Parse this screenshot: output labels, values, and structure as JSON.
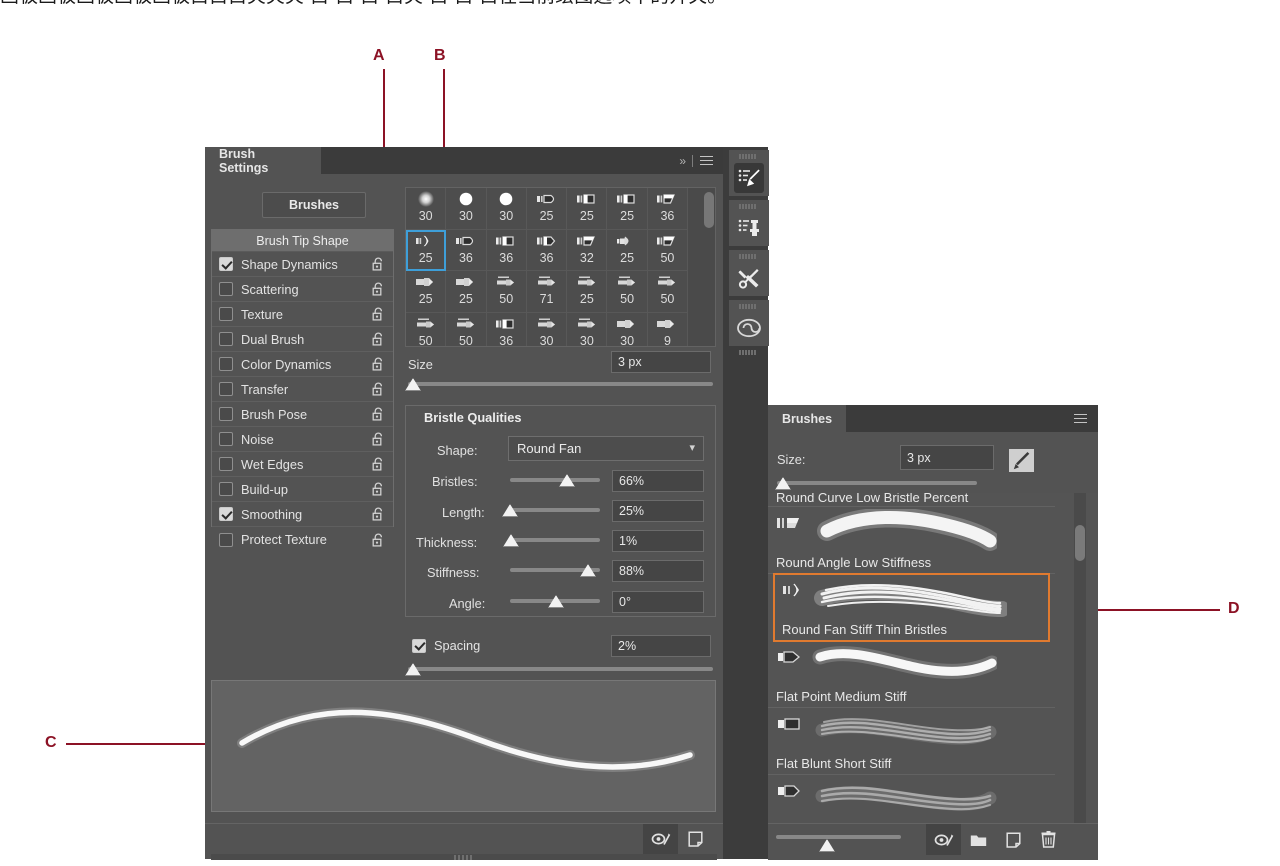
{
  "caption": "画板画板画板画板画板白白白夹夹夹·白·白·白·白夹·白·白·白在当前绘图选项中的开关。",
  "callouts": [
    {
      "id": "A",
      "label": "A"
    },
    {
      "id": "B",
      "label": "B"
    },
    {
      "id": "C",
      "label": "C"
    },
    {
      "id": "D",
      "label": "D"
    }
  ],
  "brush_settings_panel": {
    "tab_label": "Brush Settings",
    "collapse_icon": "chevron-double-right-icon",
    "menu_icon": "panel-menu-icon",
    "brushes_button_label": "Brushes",
    "options": [
      {
        "label": "Brush Tip Shape",
        "type": "header"
      },
      {
        "label": "Shape Dynamics",
        "checked": true,
        "locked": false
      },
      {
        "label": "Scattering",
        "checked": false,
        "locked": false
      },
      {
        "label": "Texture",
        "checked": false,
        "locked": false
      },
      {
        "label": "Dual Brush",
        "checked": false,
        "locked": false
      },
      {
        "label": "Color Dynamics",
        "checked": false,
        "locked": false
      },
      {
        "label": "Transfer",
        "checked": false,
        "locked": false
      },
      {
        "label": "Brush Pose",
        "checked": false,
        "locked": false
      },
      {
        "label": "Noise",
        "checked": false,
        "locked": false
      },
      {
        "label": "Wet Edges",
        "checked": false,
        "locked": false
      },
      {
        "label": "Build-up",
        "checked": false,
        "locked": false
      },
      {
        "label": "Smoothing",
        "checked": true,
        "locked": false
      },
      {
        "label": "Protect Texture",
        "checked": false,
        "locked": false
      }
    ],
    "preset_grid": {
      "selected_index": 7,
      "cells": [
        {
          "num": "30",
          "shape": "soft-round"
        },
        {
          "num": "30",
          "shape": "hard-round"
        },
        {
          "num": "30",
          "shape": "hard-round"
        },
        {
          "num": "25",
          "shape": "round-point"
        },
        {
          "num": "25",
          "shape": "flat-block"
        },
        {
          "num": "25",
          "shape": "flat-block"
        },
        {
          "num": "36",
          "shape": "flat-angle"
        },
        {
          "num": "25",
          "shape": "round-fan"
        },
        {
          "num": "36",
          "shape": "round-point"
        },
        {
          "num": "36",
          "shape": "flat-block"
        },
        {
          "num": "36",
          "shape": "flat-point"
        },
        {
          "num": "32",
          "shape": "flat-angle"
        },
        {
          "num": "25",
          "shape": "round-blunt"
        },
        {
          "num": "50",
          "shape": "flat-angle"
        },
        {
          "num": "25",
          "shape": "flat-arrow"
        },
        {
          "num": "25",
          "shape": "flat-arrow"
        },
        {
          "num": "50",
          "shape": "thin-arrow"
        },
        {
          "num": "71",
          "shape": "thin-arrow"
        },
        {
          "num": "25",
          "shape": "thin-arrow"
        },
        {
          "num": "50",
          "shape": "thin-arrow"
        },
        {
          "num": "50",
          "shape": "thin-arrow"
        },
        {
          "num": "50",
          "shape": "thin-arrow"
        },
        {
          "num": "50",
          "shape": "thin-arrow"
        },
        {
          "num": "36",
          "shape": "flat-block"
        },
        {
          "num": "30",
          "shape": "thin-arrow"
        },
        {
          "num": "30",
          "shape": "thin-arrow"
        },
        {
          "num": "30",
          "shape": "flat-arrow"
        },
        {
          "num": "9",
          "shape": "flat-arrow"
        }
      ]
    },
    "size": {
      "label": "Size",
      "value": "3 px",
      "slider_percent": 1
    },
    "bristle_qualities": {
      "title": "Bristle Qualities",
      "shape": {
        "label": "Shape:",
        "value": "Round Fan"
      },
      "sliders": [
        {
          "label": "Bristles:",
          "value": "66%",
          "percent": 66
        },
        {
          "label": "Length:",
          "value": "25%",
          "percent": 4
        },
        {
          "label": "Thickness:",
          "value": "1%",
          "percent": 6
        },
        {
          "label": "Stiffness:",
          "value": "88%",
          "percent": 88
        },
        {
          "label": "Angle:",
          "value": "0°",
          "percent": 50
        }
      ]
    },
    "spacing": {
      "label": "Spacing",
      "checked": true,
      "value": "2%",
      "percent": 1
    },
    "footer": {
      "toggle_icon": "toggle-brush-preview-icon",
      "new_icon": "new-brush-icon"
    }
  },
  "dock": {
    "items": [
      {
        "name": "brush-settings-icon",
        "active": true
      },
      {
        "name": "clone-source-icon",
        "active": false
      },
      {
        "name": "tool-presets-icon",
        "active": false
      },
      {
        "name": "creative-cloud-libraries-icon",
        "active": false
      }
    ]
  },
  "brushes_panel": {
    "tab_label": "Brushes",
    "menu_icon": "panel-menu-icon",
    "size": {
      "label": "Size:",
      "value": "3 px",
      "percent": 1
    },
    "toggle_icon": "open-preset-manager-icon",
    "list": [
      {
        "name": "Round Curve Low Bristle Percent",
        "icon": "round-curve",
        "selected": false,
        "clipped": true
      },
      {
        "name": "Round Angle Low Stiffness",
        "icon": "flat-angle",
        "selected": false
      },
      {
        "name": "Round Fan Stiff Thin Bristles",
        "icon": "round-fan",
        "selected": true
      },
      {
        "name": "Flat Point Medium Stiff",
        "icon": "flat-point",
        "selected": false
      },
      {
        "name": "Flat Blunt Short Stiff",
        "icon": "flat-block",
        "selected": false
      },
      {
        "name": "",
        "icon": "flat-point",
        "selected": false,
        "clipped": true
      }
    ],
    "footer": {
      "slider_percent": 38,
      "icons": [
        "toggle-brush-preview-icon",
        "new-group-icon",
        "new-brush-icon",
        "delete-brush-icon"
      ]
    }
  }
}
